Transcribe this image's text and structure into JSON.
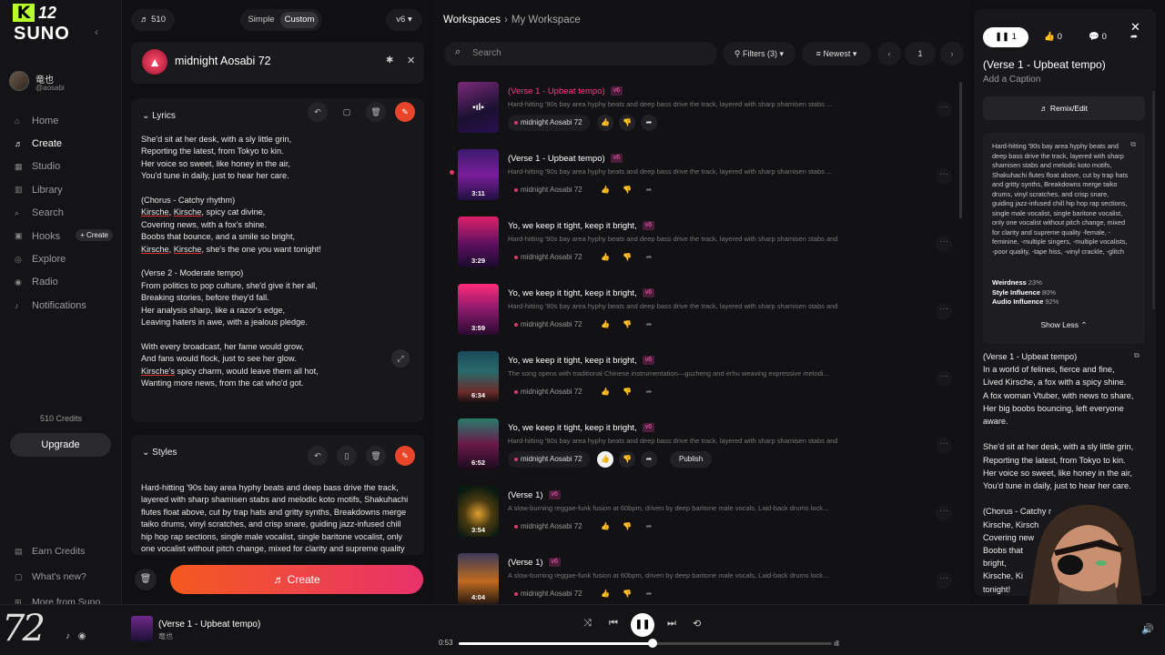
{
  "sidebar": {
    "logo": {
      "letter": "K",
      "num": "12",
      "brand": "SUNO"
    },
    "user": {
      "name": "竜也",
      "handle": "@aosabi"
    },
    "nav": [
      {
        "label": "Home",
        "icon": "home-icon",
        "glyph": "⌂"
      },
      {
        "label": "Create",
        "icon": "create-icon",
        "glyph": "♬"
      },
      {
        "label": "Studio",
        "icon": "studio-icon",
        "glyph": "▦"
      },
      {
        "label": "Library",
        "icon": "library-icon",
        "glyph": "▥"
      },
      {
        "label": "Search",
        "icon": "search-icon",
        "glyph": "⌕"
      },
      {
        "label": "Hooks",
        "icon": "hooks-icon",
        "glyph": "▣"
      },
      {
        "label": "Explore",
        "icon": "explore-icon",
        "glyph": "◎"
      },
      {
        "label": "Radio",
        "icon": "radio-icon",
        "glyph": "◉"
      },
      {
        "label": "Notifications",
        "icon": "bell-icon",
        "glyph": "♪"
      }
    ],
    "hooks_create": "+ Create",
    "credits": "510 Credits",
    "upgrade": "Upgrade",
    "bottom": [
      {
        "label": "Earn Credits",
        "icon": "earn-icon",
        "glyph": "▤"
      },
      {
        "label": "What's new?",
        "icon": "news-icon",
        "glyph": "▢"
      },
      {
        "label": "More from Suno",
        "icon": "more-icon",
        "glyph": "⊞"
      }
    ],
    "watermark": "72",
    "social_glyphs": "♪ ◉"
  },
  "creator": {
    "credits_pill": "♬ 510",
    "mode_simple": "Simple",
    "mode_custom": "Custom",
    "version": "v6 ▾",
    "persona_name": "midnight Aosabi 72",
    "lyrics_header": "Lyrics",
    "styles_header": "Styles",
    "create_label": "Create",
    "styles_text": "Hard-hitting '90s bay area hyphy beats and deep bass drive the track, layered with sharp shamisen stabs and melodic koto motifs, Shakuhachi flutes float above, cut by trap hats and gritty synths, Breakdowns merge taiko drums, vinyl scratches, and crisp snare, guiding jazz-infused chill hip hop rap sections, single male vocalist, single baritone vocalist, only one vocalist without pitch change, mixed for clarity and supreme quality"
  },
  "workspace": {
    "crumb_root": "Workspaces",
    "crumb_current": "My Workspace",
    "search_placeholder": "Search",
    "filters": "Filters (3) ▾",
    "sort": "Newest ▾",
    "page": "1",
    "songs": [
      {
        "title": "(Verse 1 - Upbeat tempo)",
        "version": "v6",
        "desc": "Hard-hitting '90s bay area hyphy beats and deep bass drive the track, layered with sharp shamisen stabs ...",
        "duration": "",
        "persona": "midnight Aosabi 72",
        "playing": true
      },
      {
        "title": "(Verse 1 - Upbeat tempo)",
        "version": "v6",
        "desc": "Hard-hitting '90s bay area hyphy beats and deep bass drive the track, layered with sharp shamisen stabs ...",
        "duration": "3:11",
        "persona": "midnight Aosabi 72"
      },
      {
        "title": "Yo, we keep it tight, keep it bright,",
        "version": "v6",
        "desc": "Hard-hitting '90s bay area hyphy beats and deep bass drive the track, layered with sharp shamisen stabs and melo...",
        "duration": "3:29",
        "persona": "midnight Aosabi 72"
      },
      {
        "title": "Yo, we keep it tight, keep it bright,",
        "version": "v6",
        "desc": "Hard-hitting '90s bay area hyphy beats and deep bass drive the track, layered with sharp shamisen stabs and melo...",
        "duration": "3:59",
        "persona": "midnight Aosabi 72"
      },
      {
        "title": "Yo, we keep it tight, keep it bright,",
        "version": "v6",
        "desc": "The song opens with traditional Chinese instrumentation—guzheng and erhu weaving expressive melodi...",
        "duration": "6:34",
        "persona": "midnight Aosabi 72"
      },
      {
        "title": "Yo, we keep it tight, keep it bright,",
        "version": "v6",
        "desc": "Hard-hitting '90s bay area hyphy beats and deep bass drive the track, layered with sharp shamisen stabs and melo...",
        "duration": "6:52",
        "persona": "midnight Aosabi 72",
        "publish": "Publish"
      },
      {
        "title": "(Verse 1)",
        "version": "v6",
        "desc": "A slow-burning reggae-funk fusion at 60bpm, driven by deep baritone male vocals, Laid-back drums lock...",
        "duration": "3:54",
        "persona": "midnight Aosabi 72"
      },
      {
        "title": "(Verse 1)",
        "version": "v6",
        "desc": "A slow-burning reggae-funk fusion at 60bpm, driven by deep baritone male vocals, Laid-back drums lock...",
        "duration": "4:04",
        "persona": "midnight Aosabi 72"
      }
    ]
  },
  "details": {
    "plays": "❚❚ 1",
    "likes": "👍 0",
    "comments": "💬 0",
    "title": "(Verse 1 - Upbeat tempo)",
    "caption": "Add a Caption",
    "remix": "♬ Remix/Edit",
    "style_text": "Hard-hitting '90s bay area hyphy beats and deep bass drive the track, layered with sharp shamisen stabs and melodic koto motifs, Shakuhachi flutes float above, cut by trap hats and gritty synths, Breakdowns merge taiko drums, vinyl scratches, and crisp snare, guiding jazz-infused chill hip hop rap sections, single male vocalist, single baritone vocalist, only one vocalist without pitch change, mixed for clarity and supreme quality -female, -feminine, -multiple singers, -multiple vocalists, -poor quality, -tape hiss, -vinyl crackle, -glitch",
    "weirdness_label": "Weirdness",
    "weirdness": "23%",
    "style_label": "Style Influence",
    "style": "80%",
    "audio_label": "Audio Influence",
    "audio": "92%",
    "show_less": "Show Less ⌃",
    "lyrics": "(Verse 1 - Upbeat tempo)\nIn a world of felines, fierce and fine,\nLived Kirsche, a fox with a spicy shine.\nA fox woman Vtuber, with news to share,\nHer big boobs bouncing, left everyone aware.\n\nShe'd sit at her desk, with a sly little grin,\nReporting the latest, from Tokyo to kin.\nHer voice so sweet, like honey in the air,\nYou'd tune in daily, just to hear her care.\n\n(Chorus - Catchy r\nKirsche, Kirsch\nCovering new\nBoobs that\nbright,\nKirsche, Ki\ntonight!"
  },
  "player": {
    "title": "(Verse 1 - Upbeat tempo)",
    "artist": "竜也",
    "time": "0:53",
    "progress": 0.52
  }
}
